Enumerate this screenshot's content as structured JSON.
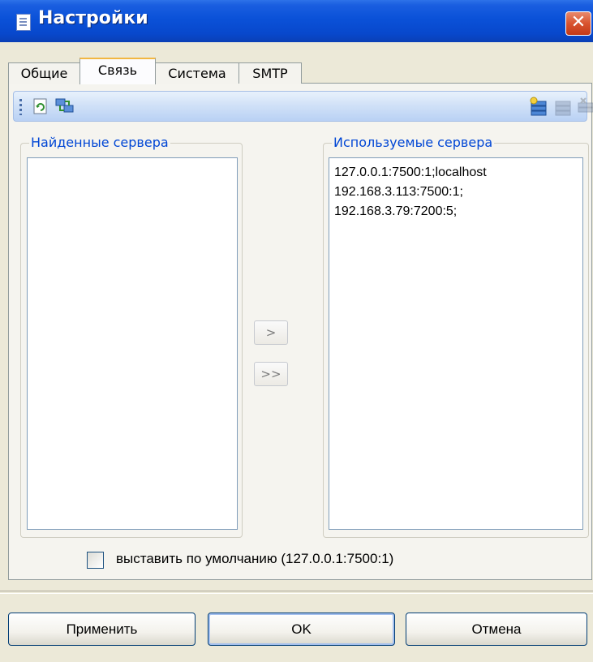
{
  "window": {
    "title": "Настройки",
    "close_glyph": "✕"
  },
  "tabs": [
    {
      "label": "Общие",
      "active": false
    },
    {
      "label": "Связь",
      "active": true
    },
    {
      "label": "Система",
      "active": false
    },
    {
      "label": "SMTP",
      "active": false
    }
  ],
  "toolbar": {
    "left_icons": [
      "refresh-icon",
      "network-connect-icon"
    ],
    "right_icons": [
      "server-add-icon",
      "server-edit-icon",
      "server-delete-icon"
    ]
  },
  "found_servers": {
    "legend": "Найденные сервера",
    "items": []
  },
  "used_servers": {
    "legend": "Используемые сервера",
    "items": [
      "127.0.0.1:7500:1;localhost",
      "192.168.3.113:7500:1;",
      "192.168.3.79:7200:5;"
    ]
  },
  "move_buttons": {
    "move_one": ">",
    "move_all": ">>"
  },
  "default_checkbox": {
    "label": "выставить по умолчанию (127.0.0.1:7500:1)",
    "checked": false
  },
  "buttons": {
    "apply": "Применить",
    "ok": "OK",
    "cancel": "Отмена"
  },
  "colors": {
    "titlebar": "#0a51d8",
    "legend_text": "#0046d5",
    "active_tab_highlight": "#f2b742"
  }
}
